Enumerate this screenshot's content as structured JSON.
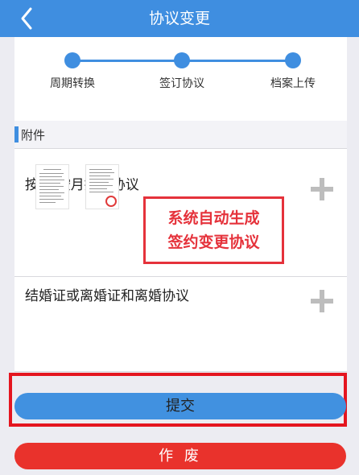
{
  "header": {
    "title": "协议变更"
  },
  "steps": [
    {
      "label": "周期转换"
    },
    {
      "label": "签订协议"
    },
    {
      "label": "档案上传"
    }
  ],
  "section": {
    "label": "附件"
  },
  "attachments": [
    {
      "title": "按年/按月提取协议"
    },
    {
      "title": "结婚证或离婚证和离婚协议"
    }
  ],
  "annotation": {
    "line1": "系统自动生成",
    "line2": "签约变更协议"
  },
  "buttons": {
    "submit": "提交",
    "void": "作 废"
  },
  "colors": {
    "primary": "#3f8ee0",
    "danger": "#e9322c",
    "highlight": "#e4151f"
  }
}
